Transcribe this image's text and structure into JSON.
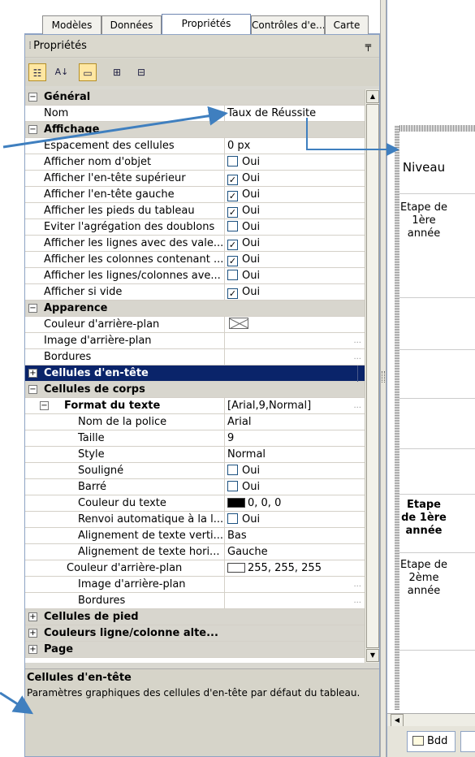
{
  "tabs": [
    {
      "label": "Modèles",
      "active": false
    },
    {
      "label": "Données",
      "active": false
    },
    {
      "label": "Propriétés",
      "active": true
    },
    {
      "label": "Contrôles d'e...",
      "active": false
    },
    {
      "label": "Carte",
      "active": false
    }
  ],
  "panel": {
    "title": "Propriétés",
    "pin_icon": "pin-icon"
  },
  "toolbar": {
    "buttons": [
      {
        "icon": "categorized-icon",
        "glyph": "☷",
        "active": true
      },
      {
        "icon": "alphabetical-sort-icon",
        "glyph": "A↓",
        "active": false
      },
      {
        "icon": "property-pages-icon",
        "glyph": "▭",
        "active": true
      },
      {
        "icon": "expand-all-icon",
        "glyph": "⊞",
        "active": false
      },
      {
        "icon": "collapse-all-icon",
        "glyph": "⊟",
        "active": false
      }
    ]
  },
  "properties": [
    {
      "label": "Général",
      "kind": "category",
      "expander": "⊟"
    },
    {
      "label": "Nom",
      "value": "Taux de Réussite"
    },
    {
      "label": "Affichage",
      "kind": "category",
      "expander": "⊟"
    },
    {
      "label": "Espacement des cellules",
      "value": "0 px"
    },
    {
      "label": "Afficher nom d'objet",
      "value": "Oui",
      "checkbox": false
    },
    {
      "label": "Afficher l'en-tête supérieur",
      "value": "Oui",
      "checkbox": true
    },
    {
      "label": "Afficher l'en-tête gauche",
      "value": "Oui",
      "checkbox": true
    },
    {
      "label": "Afficher les pieds du tableau",
      "value": "Oui",
      "checkbox": true
    },
    {
      "label": "Eviter l'agrégation des doublons",
      "value": "Oui",
      "checkbox": false
    },
    {
      "label": "Afficher les lignes avec des vale...",
      "value": "Oui",
      "checkbox": true
    },
    {
      "label": "Afficher les colonnes contenant ...",
      "value": "Oui",
      "checkbox": true
    },
    {
      "label": "Afficher les lignes/colonnes ave...",
      "value": "Oui",
      "checkbox": false
    },
    {
      "label": "Afficher si vide",
      "value": "Oui",
      "checkbox": true
    },
    {
      "label": "Apparence",
      "kind": "category",
      "expander": "⊟"
    },
    {
      "label": "Couleur d'arrière-plan",
      "value": "",
      "envelope": true
    },
    {
      "label": "Image d'arrière-plan",
      "value": "",
      "ellipsis": true
    },
    {
      "label": "Bordures",
      "value": "",
      "ellipsis": true
    },
    {
      "label": "Cellules d'en-tête",
      "kind": "category",
      "expander": "⊞",
      "selected": true
    },
    {
      "label": "Cellules de corps",
      "kind": "category",
      "expander": "⊟"
    },
    {
      "label": "Format du texte",
      "value": "[Arial,9,Normal]",
      "bold": true,
      "expander": "⊟",
      "indent": 1,
      "ellipsis": true
    },
    {
      "label": "Nom de la police",
      "value": "Arial",
      "indent": 3
    },
    {
      "label": "Taille",
      "value": "9",
      "indent": 3
    },
    {
      "label": "Style",
      "value": "Normal",
      "indent": 3
    },
    {
      "label": "Souligné",
      "value": "Oui",
      "checkbox": false,
      "indent": 3
    },
    {
      "label": "Barré",
      "value": "Oui",
      "checkbox": false,
      "indent": 3
    },
    {
      "label": "Couleur du texte",
      "value": "0, 0, 0",
      "swatch": "#000000",
      "indent": 3
    },
    {
      "label": "Renvoi automatique à la l...",
      "value": "Oui",
      "checkbox": false,
      "indent": 3
    },
    {
      "label": "Alignement de texte verti...",
      "value": "Bas",
      "indent": 3
    },
    {
      "label": "Alignement de texte hori...",
      "value": "Gauche",
      "indent": 3
    },
    {
      "label": "Couleur d'arrière-plan",
      "value": "255, 255, 255",
      "swatch": "#ffffff",
      "indent": 2
    },
    {
      "label": "Image d'arrière-plan",
      "value": "",
      "indent": 3,
      "ellipsis": true
    },
    {
      "label": "Bordures",
      "value": "",
      "indent": 3,
      "ellipsis": true
    },
    {
      "label": "Cellules de pied",
      "kind": "category",
      "expander": "⊞"
    },
    {
      "label": "Couleurs ligne/colonne alte...",
      "kind": "category",
      "expander": "⊞"
    },
    {
      "label": "Page",
      "kind": "category",
      "expander": "⊞"
    }
  ],
  "description": {
    "title": "Cellules d'en-tête",
    "text": "Paramètres graphiques des cellules d'en-tête par défaut du tableau."
  },
  "report": {
    "header": "Niveau",
    "cells": [
      {
        "text": "Etape de 1ère année",
        "bold": false
      },
      {
        "text": "Etape de 1ère année",
        "bold": true
      },
      {
        "text": "Etape de 2ème année",
        "bold": false
      }
    ],
    "bottom_tab": "Bdd"
  },
  "colors": {
    "selection": "#0a246a",
    "arrow": "#3f7fbf"
  }
}
